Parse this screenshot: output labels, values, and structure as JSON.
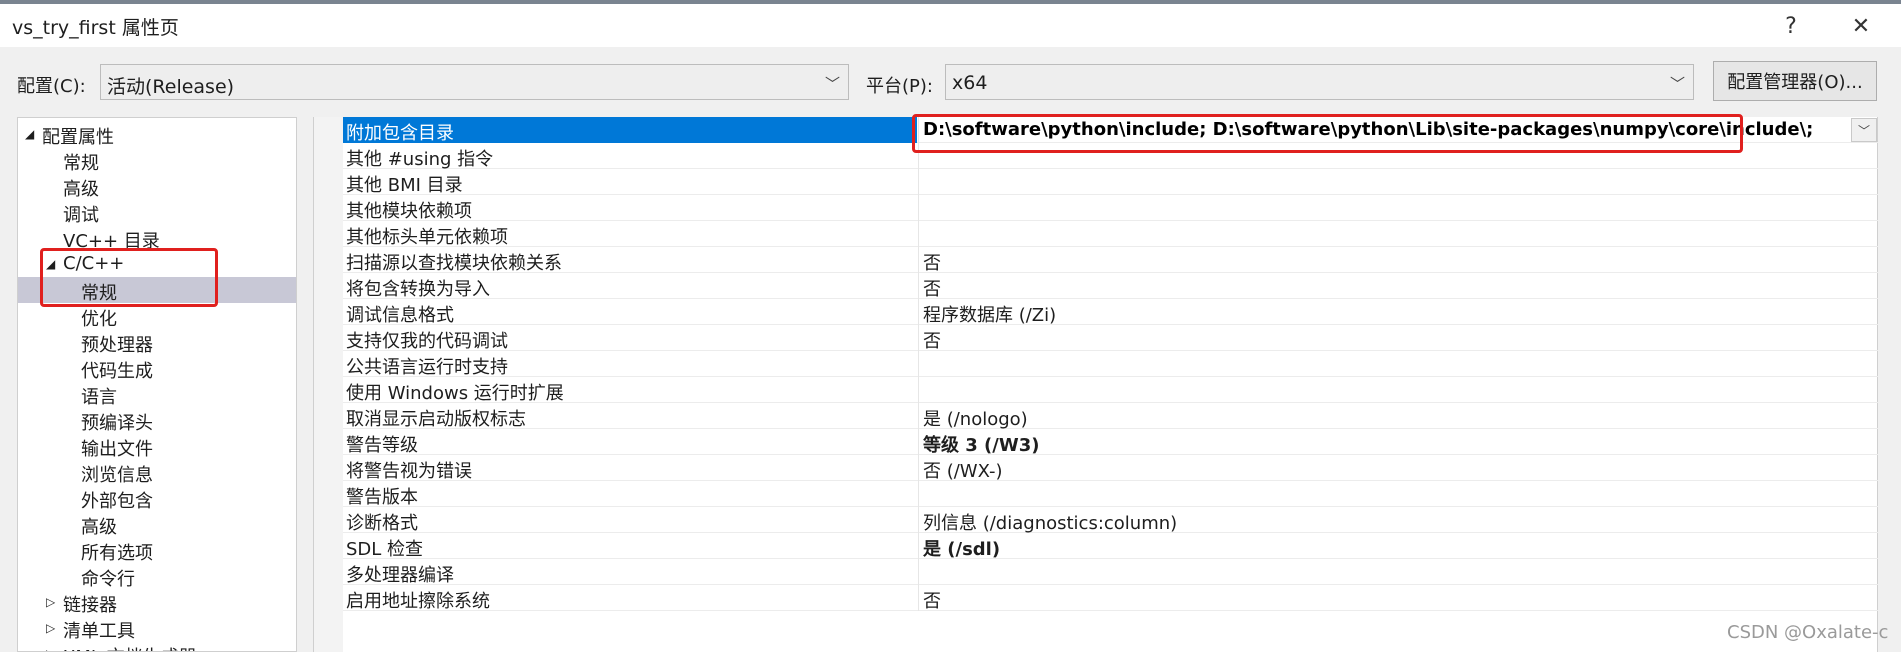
{
  "window": {
    "title": "vs_try_first 属性页",
    "help_glyph": "?",
    "close_glyph": "✕"
  },
  "config_bar": {
    "config_label": "配置(C):",
    "config_value": "活动(Release)",
    "platform_label": "平台(P):",
    "platform_value": "x64",
    "manager_button": "配置管理器(O)..."
  },
  "tree": [
    {
      "label": "配置属性",
      "expander": "◢",
      "level": 0
    },
    {
      "label": "常规",
      "level": 1
    },
    {
      "label": "高级",
      "level": 1
    },
    {
      "label": "调试",
      "level": 1
    },
    {
      "label": "VC++ 目录",
      "level": 1
    },
    {
      "label": "C/C++",
      "expander": "◢",
      "level": 1
    },
    {
      "label": "常规",
      "level": 2,
      "selected": true
    },
    {
      "label": "优化",
      "level": 2
    },
    {
      "label": "预处理器",
      "level": 2
    },
    {
      "label": "代码生成",
      "level": 2
    },
    {
      "label": "语言",
      "level": 2
    },
    {
      "label": "预编译头",
      "level": 2
    },
    {
      "label": "输出文件",
      "level": 2
    },
    {
      "label": "浏览信息",
      "level": 2
    },
    {
      "label": "外部包含",
      "level": 2
    },
    {
      "label": "高级",
      "level": 2
    },
    {
      "label": "所有选项",
      "level": 2
    },
    {
      "label": "命令行",
      "level": 2
    },
    {
      "label": "链接器",
      "expander": "▷",
      "level": 1
    },
    {
      "label": "清单工具",
      "expander": "▷",
      "level": 1
    },
    {
      "label": "XML 文档生成器",
      "expander": "▷",
      "level": 1
    }
  ],
  "properties": [
    {
      "name": "附加包含目录",
      "value": "D:\\software\\python\\include; D:\\software\\python\\Lib\\site-packages\\numpy\\core\\include\\;",
      "selected": true
    },
    {
      "name": "其他 #using 指令",
      "value": ""
    },
    {
      "name": "其他 BMI 目录",
      "value": ""
    },
    {
      "name": "其他模块依赖项",
      "value": ""
    },
    {
      "name": "其他标头单元依赖项",
      "value": ""
    },
    {
      "name": "扫描源以查找模块依赖关系",
      "value": "否"
    },
    {
      "name": "将包含转换为导入",
      "value": "否"
    },
    {
      "name": "调试信息格式",
      "value": "程序数据库 (/Zi)"
    },
    {
      "name": "支持仅我的代码调试",
      "value": "否"
    },
    {
      "name": "公共语言运行时支持",
      "value": ""
    },
    {
      "name": "使用 Windows 运行时扩展",
      "value": ""
    },
    {
      "name": "取消显示启动版权标志",
      "value": "是 (/nologo)"
    },
    {
      "name": "警告等级",
      "value": "等级 3 (/W3)",
      "bold": true
    },
    {
      "name": "将警告视为错误",
      "value": "否 (/WX-)"
    },
    {
      "name": "警告版本",
      "value": ""
    },
    {
      "name": "诊断格式",
      "value": "列信息 (/diagnostics:column)"
    },
    {
      "name": "SDL 检查",
      "value": "是 (/sdl)",
      "bold": true
    },
    {
      "name": "多处理器编译",
      "value": ""
    },
    {
      "name": "启用地址擦除系统",
      "value": "否"
    }
  ],
  "watermark": "CSDN @Oxalate-c",
  "colors": {
    "selection_blue": "#0078d7",
    "tree_selected": "#c8c8d6",
    "annotation_red": "#e0201e"
  }
}
